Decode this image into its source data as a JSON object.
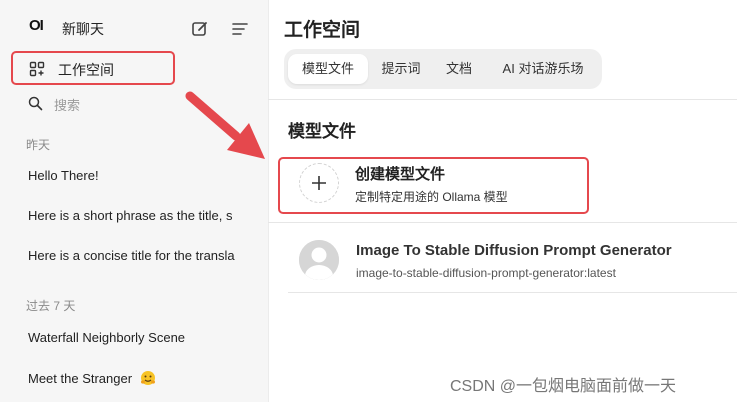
{
  "sidebar": {
    "logo": "OI",
    "new_chat_label": "新聊天",
    "workspace_label": "工作空间",
    "search_placeholder": "搜索",
    "sections": [
      {
        "title": "昨天",
        "chats": [
          "Hello There!",
          "Here is a short phrase as the title, s",
          "Here is a concise title for the transla"
        ]
      },
      {
        "title": "过去 7 天",
        "chats": [
          "Waterfall Neighborly Scene",
          "Meet the Stranger"
        ]
      }
    ]
  },
  "main": {
    "title": "工作空间",
    "tabs": [
      {
        "label": "模型文件",
        "active": true
      },
      {
        "label": "提示词",
        "active": false
      },
      {
        "label": "文档",
        "active": false
      },
      {
        "label": "AI 对话游乐场",
        "active": false
      }
    ],
    "section_title": "模型文件",
    "create_card": {
      "title": "创建模型文件",
      "description": "定制特定用途的 Ollama 模型"
    },
    "models": [
      {
        "name": "Image To Stable Diffusion Prompt Generator",
        "id": "image-to-stable-diffusion-prompt-generator:latest"
      }
    ]
  },
  "annotations": {
    "highlight_color": "#e5484d"
  },
  "watermark": "CSDN @一包烟电脑面前做一天"
}
